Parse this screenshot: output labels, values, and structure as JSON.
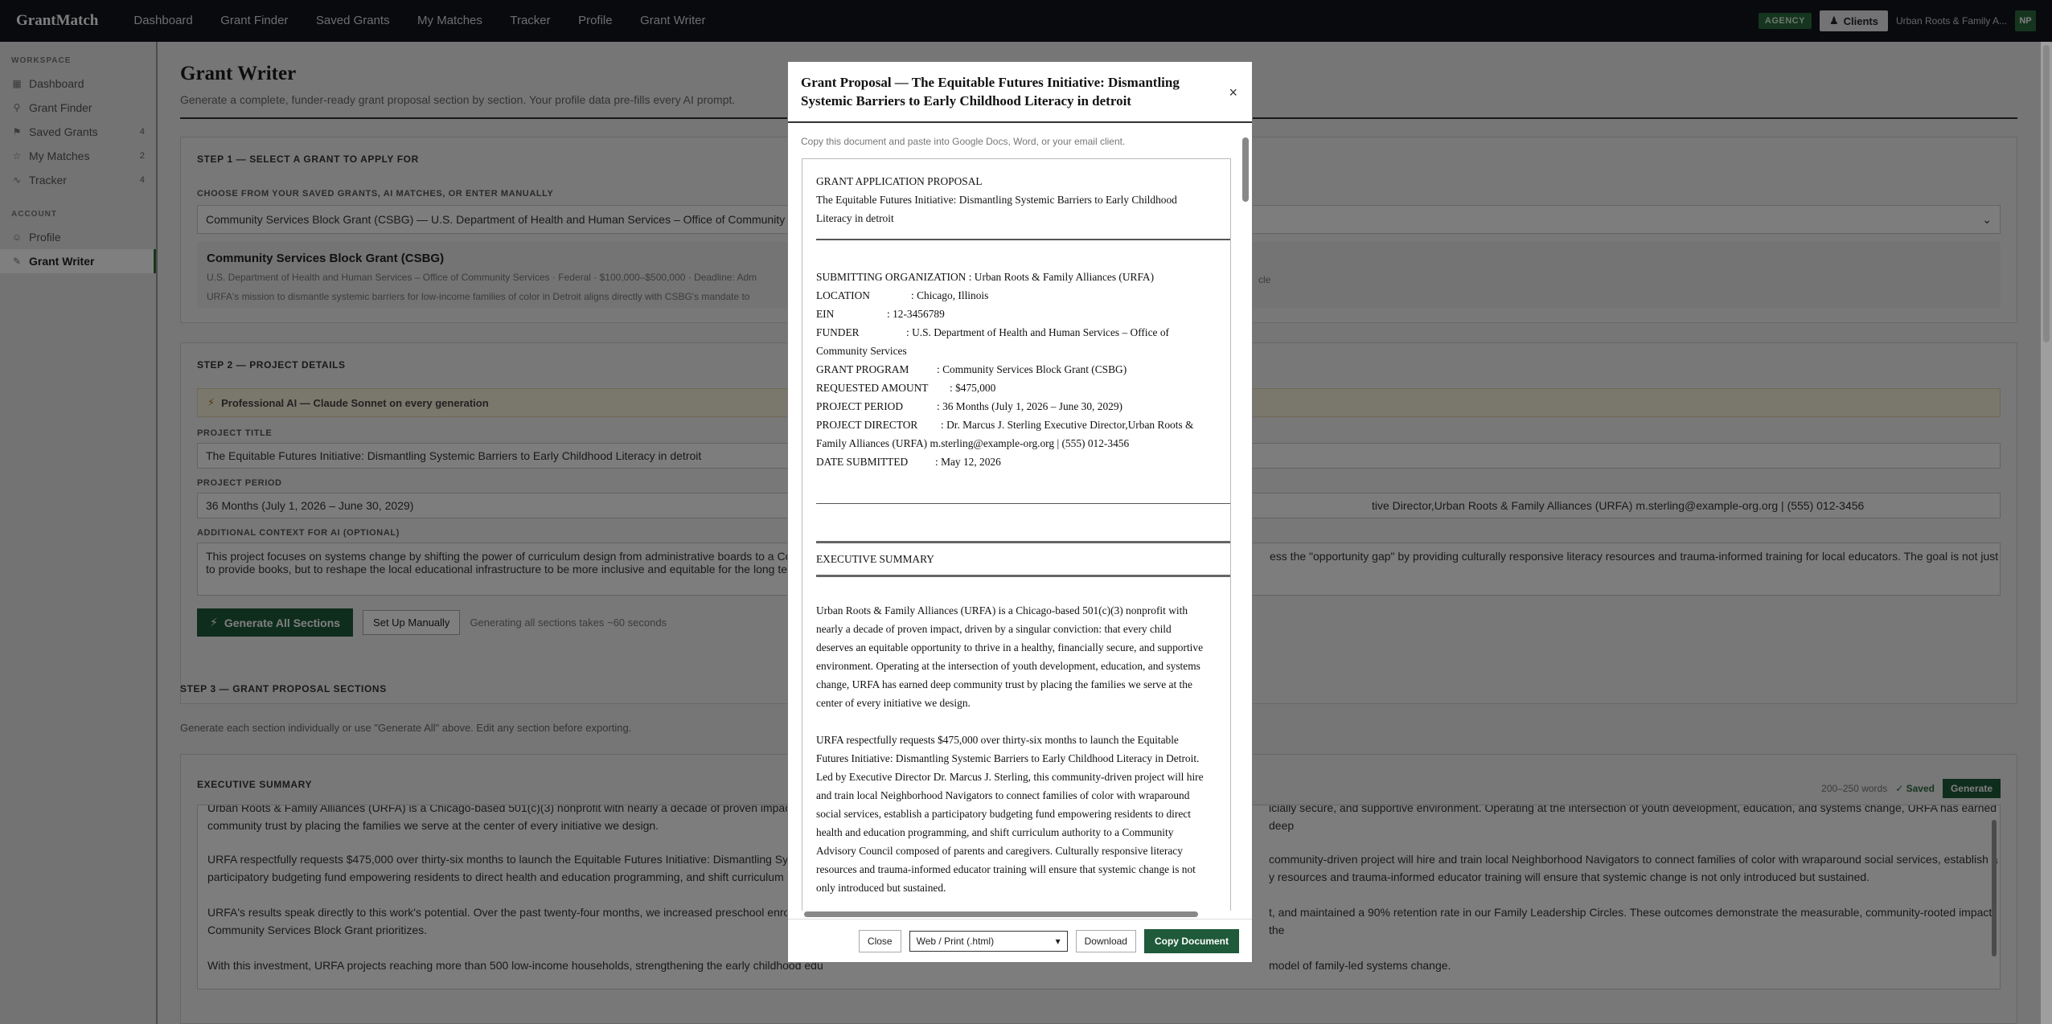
{
  "app": {
    "brand": "GrantMatch",
    "nav": [
      "Dashboard",
      "Grant Finder",
      "Saved Grants",
      "My Matches",
      "Tracker",
      "Profile",
      "Grant Writer"
    ],
    "agency_badge": "AGENCY",
    "clients_label": "Clients",
    "org_name": "Urban Roots & Family A...",
    "avatar": "NP"
  },
  "sidebar": {
    "workspace_label": "WORKSPACE",
    "account_label": "ACCOUNT",
    "workspace_items": [
      {
        "label": "Dashboard",
        "count": ""
      },
      {
        "label": "Grant Finder",
        "count": ""
      },
      {
        "label": "Saved Grants",
        "count": "4"
      },
      {
        "label": "My Matches",
        "count": "2"
      },
      {
        "label": "Tracker",
        "count": "4"
      }
    ],
    "account_items": [
      {
        "label": "Profile"
      },
      {
        "label": "Grant Writer"
      }
    ]
  },
  "page": {
    "title": "Grant Writer",
    "subtitle": "Generate a complete, funder-ready grant proposal section by section. Your profile data pre-fills every AI prompt."
  },
  "step1": {
    "heading": "STEP 1 — SELECT A GRANT TO APPLY FOR",
    "choose_label": "CHOOSE FROM YOUR SAVED GRANTS, AI MATCHES, OR ENTER MANUALLY",
    "selected_value": "Community Services Block Grant (CSBG) — U.S. Department of Health and Human Services – Office of Community Se",
    "grant_name": "Community Services Block Grant (CSBG)",
    "grant_meta": "U.S. Department of Health and Human Services – Office of Community Services · Federal · $100,000–$500,000 · Deadline: Adm",
    "grant_meta_tail": "cle",
    "grant_fit": "URFA's mission to dismantle systemic barriers for low-income families of color in Detroit aligns directly with CSBG's mandate to"
  },
  "step2": {
    "heading": "STEP 2 — PROJECT DETAILS",
    "ai_banner": "Professional AI — Claude Sonnet on every generation",
    "title_label": "PROJECT TITLE",
    "title_value": "The Equitable Futures Initiative: Dismantling Systemic Barriers to Early Childhood Literacy in detroit",
    "period_label": "PROJECT PERIOD",
    "period_value": "36 Months (July 1, 2026 – June 30, 2029)",
    "director_value_tail": "tive Director,Urban Roots & Family Alliances (URFA) m.sterling@example-org.org | (555) 012-3456",
    "context_label": "ADDITIONAL CONTEXT FOR AI (OPTIONAL)",
    "context_line1": "This project focuses on systems change by shifting the power of curriculum design from administrative boards to a Co",
    "context_line1_tail": "ess the \"opportunity gap\" by providing culturally responsive literacy resources and trauma-informed training for local educators. The goal is not just",
    "context_line2": "to provide books, but to reshape the local educational infrastructure to be more inclusive and equitable for the long te",
    "generate_all": "Generate All Sections",
    "setup_manual": "Set Up Manually",
    "generate_note": "Generating all sections takes ~60 seconds"
  },
  "step3": {
    "heading": "STEP 3 — GRANT PROPOSAL SECTIONS",
    "sub": "Generate each section individually or use \"Generate All\" above. Edit any section before exporting.",
    "exec_heading": "EXECUTIVE SUMMARY",
    "word_range": "200–250 words",
    "saved": "✓ Saved",
    "generate": "Generate",
    "p0a": "Urban Roots & Family Alliances (URFA) is a Chicago-based 501(c)(3) nonprofit with nearly a decade of proven impact, driven",
    "p0b": "icially secure, and supportive environment. Operating at the intersection of youth development, education, and systems change, URFA has earned deep",
    "p0c": "community trust by placing the families we serve at the center of every initiative we design.",
    "p1a": "URFA respectfully requests $475,000 over thirty-six months to launch the Equitable Futures Initiative: Dismantling Systemic",
    "p1b": "community-driven project will hire and train local Neighborhood Navigators to connect families of color with wraparound social services, establish a",
    "p1c": "participatory budgeting fund empowering residents to direct health and education programming, and shift curriculum authori",
    "p1d": "y resources and trauma-informed educator training will ensure that systemic change is not only introduced but sustained.",
    "p2a": "URFA's results speak directly to this work's potential. Over the past twenty-four months, we increased preschool enrollment by",
    "p2b": "t, and maintained a 90% retention rate in our Family Leadership Circles. These outcomes demonstrate the measurable, community-rooted impact the",
    "p2c": "Community Services Block Grant prioritizes.",
    "p3a": "With this investment, URFA projects reaching more than 500 low-income households, strengthening the early childhood edu",
    "p3b": "model of family-led systems change."
  },
  "modal": {
    "title": "Grant Proposal — The Equitable Futures Initiative: Dismantling Systemic Barriers to Early Childhood Literacy in detroit",
    "close_x": "×",
    "copy_note": "Copy this document and paste into Google Docs, Word, or your email client.",
    "doc": {
      "heading": "GRANT APPLICATION PROPOSAL",
      "subheading": "The Equitable Futures Initiative: Dismantling Systemic Barriers to Early Childhood Literacy in detroit",
      "fields": [
        {
          "k": "SUBMITTING ORGANIZATION",
          "v": ": Urban Roots & Family Alliances (URFA)"
        },
        {
          "k": "LOCATION",
          "v": ": Chicago, Illinois"
        },
        {
          "k": "EIN",
          "v": ": 12-3456789"
        },
        {
          "k": "FUNDER",
          "v": ": U.S. Department of Health and Human Services – Office of Community Services"
        },
        {
          "k": "GRANT PROGRAM",
          "v": ": Community Services Block Grant (CSBG)"
        },
        {
          "k": "REQUESTED AMOUNT",
          "v": ": $475,000"
        },
        {
          "k": "PROJECT PERIOD",
          "v": ": 36 Months (July 1, 2026 – June 30, 2029)"
        },
        {
          "k": "PROJECT DIRECTOR",
          "v": ": Dr. Marcus J. Sterling  Executive Director,Urban Roots & Family Alliances (URFA) m.sterling@example-org.org | (555) 012-3456"
        },
        {
          "k": "DATE SUBMITTED",
          "v": ": May 12, 2026"
        }
      ],
      "exec_heading": "EXECUTIVE SUMMARY",
      "para1": "Urban Roots & Family Alliances (URFA) is a Chicago-based 501(c)(3) nonprofit with nearly a decade of proven impact, driven by a singular conviction: that every child deserves an equitable opportunity to thrive in a healthy, financially secure, and supportive environment. Operating at the intersection of youth development, education, and systems change, URFA has earned deep community trust by placing the families we serve at the center of every initiative we design.",
      "para2": "URFA respectfully requests $475,000 over thirty-six months to launch the Equitable Futures Initiative: Dismantling Systemic Barriers to Early Childhood Literacy in Detroit. Led by Executive Director Dr. Marcus J. Sterling, this community-driven project will hire and train local Neighborhood Navigators to connect families of color with wraparound social services, establish a participatory budgeting fund empowering residents to direct health and education programming, and shift curriculum authority to a Community Advisory Council composed of parents and caregivers. Culturally responsive literacy resources and trauma-informed educator training will ensure that systemic change is not only introduced but sustained."
    },
    "footer": {
      "close": "Close",
      "format": "Web / Print (.html)",
      "download": "Download",
      "copy": "Copy Document"
    }
  }
}
